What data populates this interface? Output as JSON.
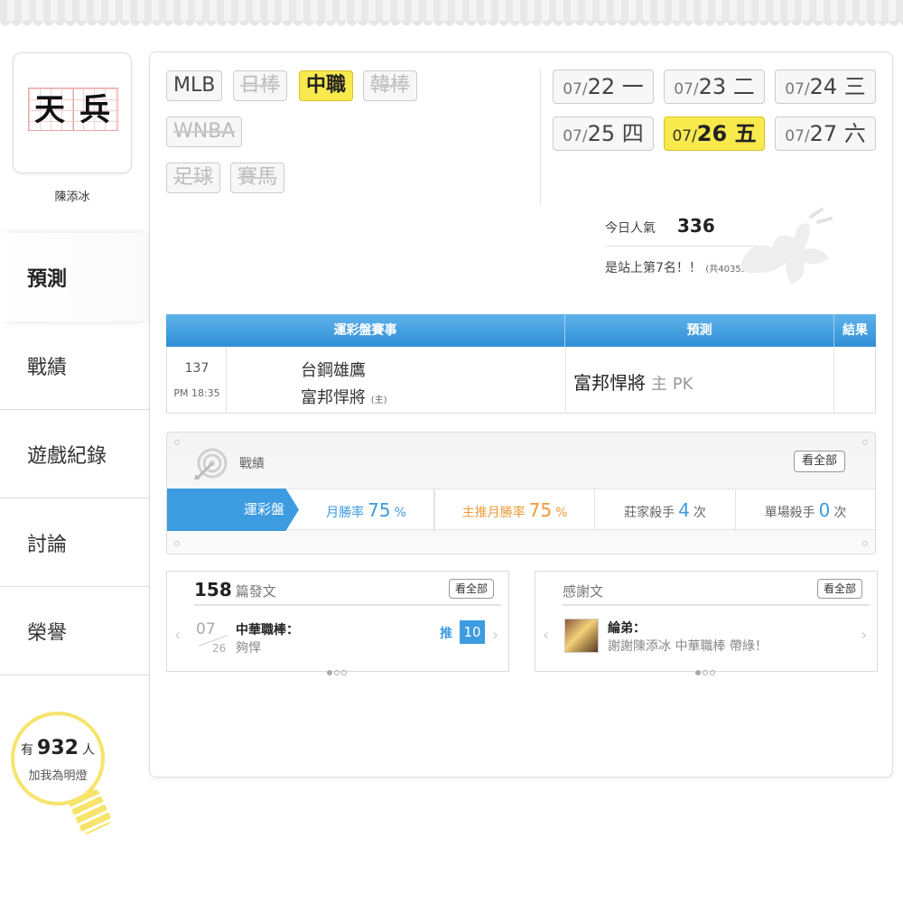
{
  "profile": {
    "avatar_chars": [
      "天",
      "兵"
    ],
    "name": "陳添冰"
  },
  "sidebar": {
    "items": [
      {
        "label": "預測",
        "active": true
      },
      {
        "label": "戰績"
      },
      {
        "label": "遊戲紀錄"
      },
      {
        "label": "討論"
      },
      {
        "label": "榮譽"
      }
    ]
  },
  "fans": {
    "prefix": "有",
    "count": "932",
    "suffix": "人",
    "caption": "加我為明燈"
  },
  "leagues": [
    {
      "label": "MLB",
      "state": "normal"
    },
    {
      "label": "日棒",
      "state": "disabled"
    },
    {
      "label": "中職",
      "state": "active"
    },
    {
      "label": "韓棒",
      "state": "disabled"
    },
    {
      "label": "WNBA",
      "state": "disabled"
    },
    {
      "label": "足球",
      "state": "disabled"
    },
    {
      "label": "賽馬",
      "state": "disabled"
    }
  ],
  "dates": [
    {
      "md_month": "07/",
      "day": "22",
      "weekday": "一"
    },
    {
      "md_month": "07/",
      "day": "23",
      "weekday": "二"
    },
    {
      "md_month": "07/",
      "day": "24",
      "weekday": "三"
    },
    {
      "md_month": "07/",
      "day": "25",
      "weekday": "四"
    },
    {
      "md_month": "07/",
      "day": "26",
      "weekday": "五",
      "active": true
    },
    {
      "md_month": "07/",
      "day": "27",
      "weekday": "六"
    }
  ],
  "popularity": {
    "label": "今日人氣",
    "value": "336",
    "rank_text": "是站上第7名！！",
    "rank_total": "(共4035人)"
  },
  "table": {
    "headers": [
      "運彩盤賽事",
      "預測",
      "結果"
    ],
    "rows": [
      {
        "no": "137",
        "time": "PM 18:35",
        "away": "台鋼雄鷹",
        "home": "富邦悍將",
        "home_mark": "(主)",
        "prediction": "富邦悍將",
        "prediction_extra": "主 PK",
        "result": ""
      }
    ]
  },
  "record": {
    "title": "戰績",
    "see_all": "看全部",
    "tab": "運彩盤",
    "stats": [
      {
        "label": "月勝率",
        "value": "75",
        "unit": "%"
      },
      {
        "label": "主推月勝率",
        "value": "75",
        "unit": "%"
      },
      {
        "label": "莊家殺手",
        "value": "4",
        "unit": "次"
      },
      {
        "label": "單場殺手",
        "value": "0",
        "unit": "次"
      }
    ]
  },
  "posts": {
    "count": "158",
    "unit": "篇發文",
    "see_all": "看全部",
    "item": {
      "month": "07",
      "day": "26",
      "category": "中華職棒：",
      "snippet": "夠悍",
      "push_label": "推",
      "push_count": "10"
    }
  },
  "thanks": {
    "title": "感謝文",
    "see_all": "看全部",
    "item": {
      "author": "綸弟：",
      "message": "謝謝陳添冰 中華職棒 帶綠！"
    }
  },
  "colors": {
    "accent_blue": "#3d9be0",
    "accent_yellow": "#f8e94d",
    "accent_orange": "#ee9a3a"
  }
}
